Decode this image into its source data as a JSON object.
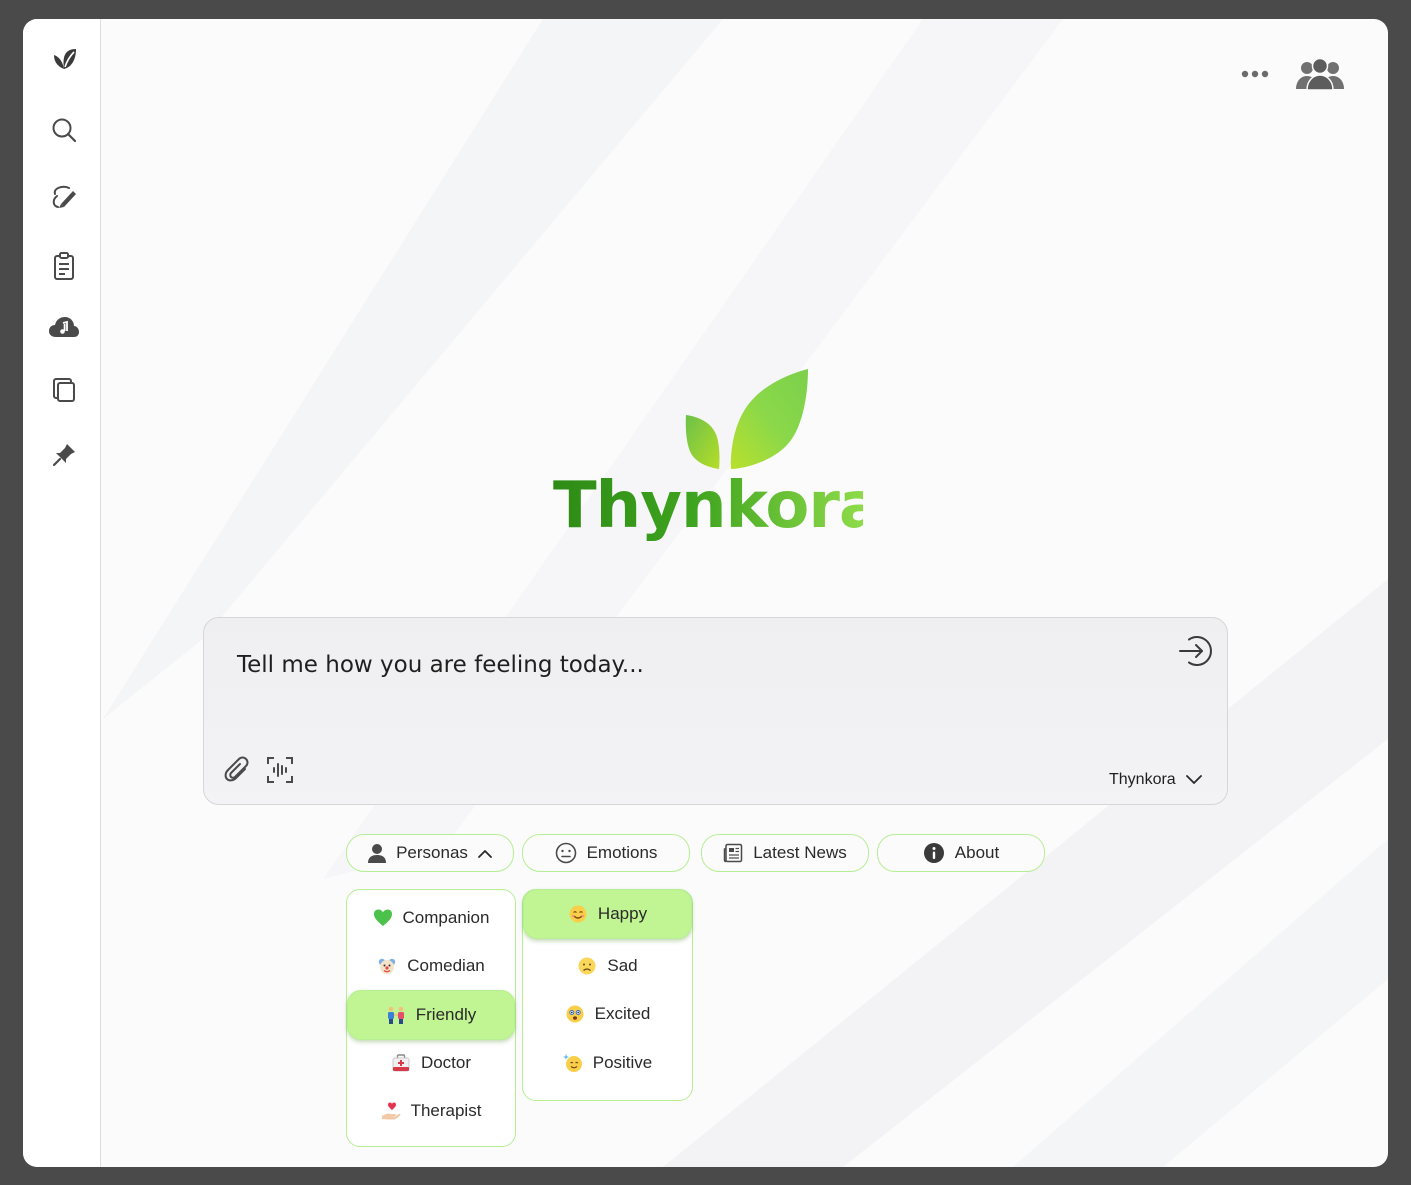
{
  "app": {
    "brand": "Thynkora"
  },
  "sidebar": {
    "items": [
      {
        "icon": "leaf-icon",
        "label": "Home"
      },
      {
        "icon": "search-icon",
        "label": "Search"
      },
      {
        "icon": "brush-icon",
        "label": "Draw"
      },
      {
        "icon": "clipboard-icon",
        "label": "Notes"
      },
      {
        "icon": "cloud-music-icon",
        "label": "Music"
      },
      {
        "icon": "copy-icon",
        "label": "Library"
      },
      {
        "icon": "pin-icon",
        "label": "Pinned"
      }
    ]
  },
  "header": {
    "more_icon": "more-horizontal-icon",
    "users_icon": "users-icon"
  },
  "prompt": {
    "placeholder": "Tell me how you are feeling today...",
    "model": "Thynkora"
  },
  "pills": {
    "personas": "Personas",
    "emotions": "Emotions",
    "news": "Latest News",
    "about": "About"
  },
  "personas_menu": {
    "items": [
      {
        "label": "Companion",
        "icon": "green-heart-icon",
        "selected": false
      },
      {
        "label": "Comedian",
        "icon": "clown-face-icon",
        "selected": false
      },
      {
        "label": "Friendly",
        "icon": "people-holding-hands-icon",
        "selected": true
      },
      {
        "label": "Doctor",
        "icon": "medical-kit-icon",
        "selected": false
      },
      {
        "label": "Therapist",
        "icon": "hand-heart-icon",
        "selected": false
      }
    ]
  },
  "emotions_menu": {
    "items": [
      {
        "label": "Happy",
        "icon": "happy-face-icon",
        "selected": true
      },
      {
        "label": "Sad",
        "icon": "sad-face-icon",
        "selected": false
      },
      {
        "label": "Excited",
        "icon": "excited-face-icon",
        "selected": false
      },
      {
        "label": "Positive",
        "icon": "sparkle-face-icon",
        "selected": false
      }
    ]
  },
  "colors": {
    "accent": "#b6ef93",
    "accent_fill": "#c1f493",
    "brand_dark": "#2e8b16",
    "brand_light": "#8edb4a"
  }
}
